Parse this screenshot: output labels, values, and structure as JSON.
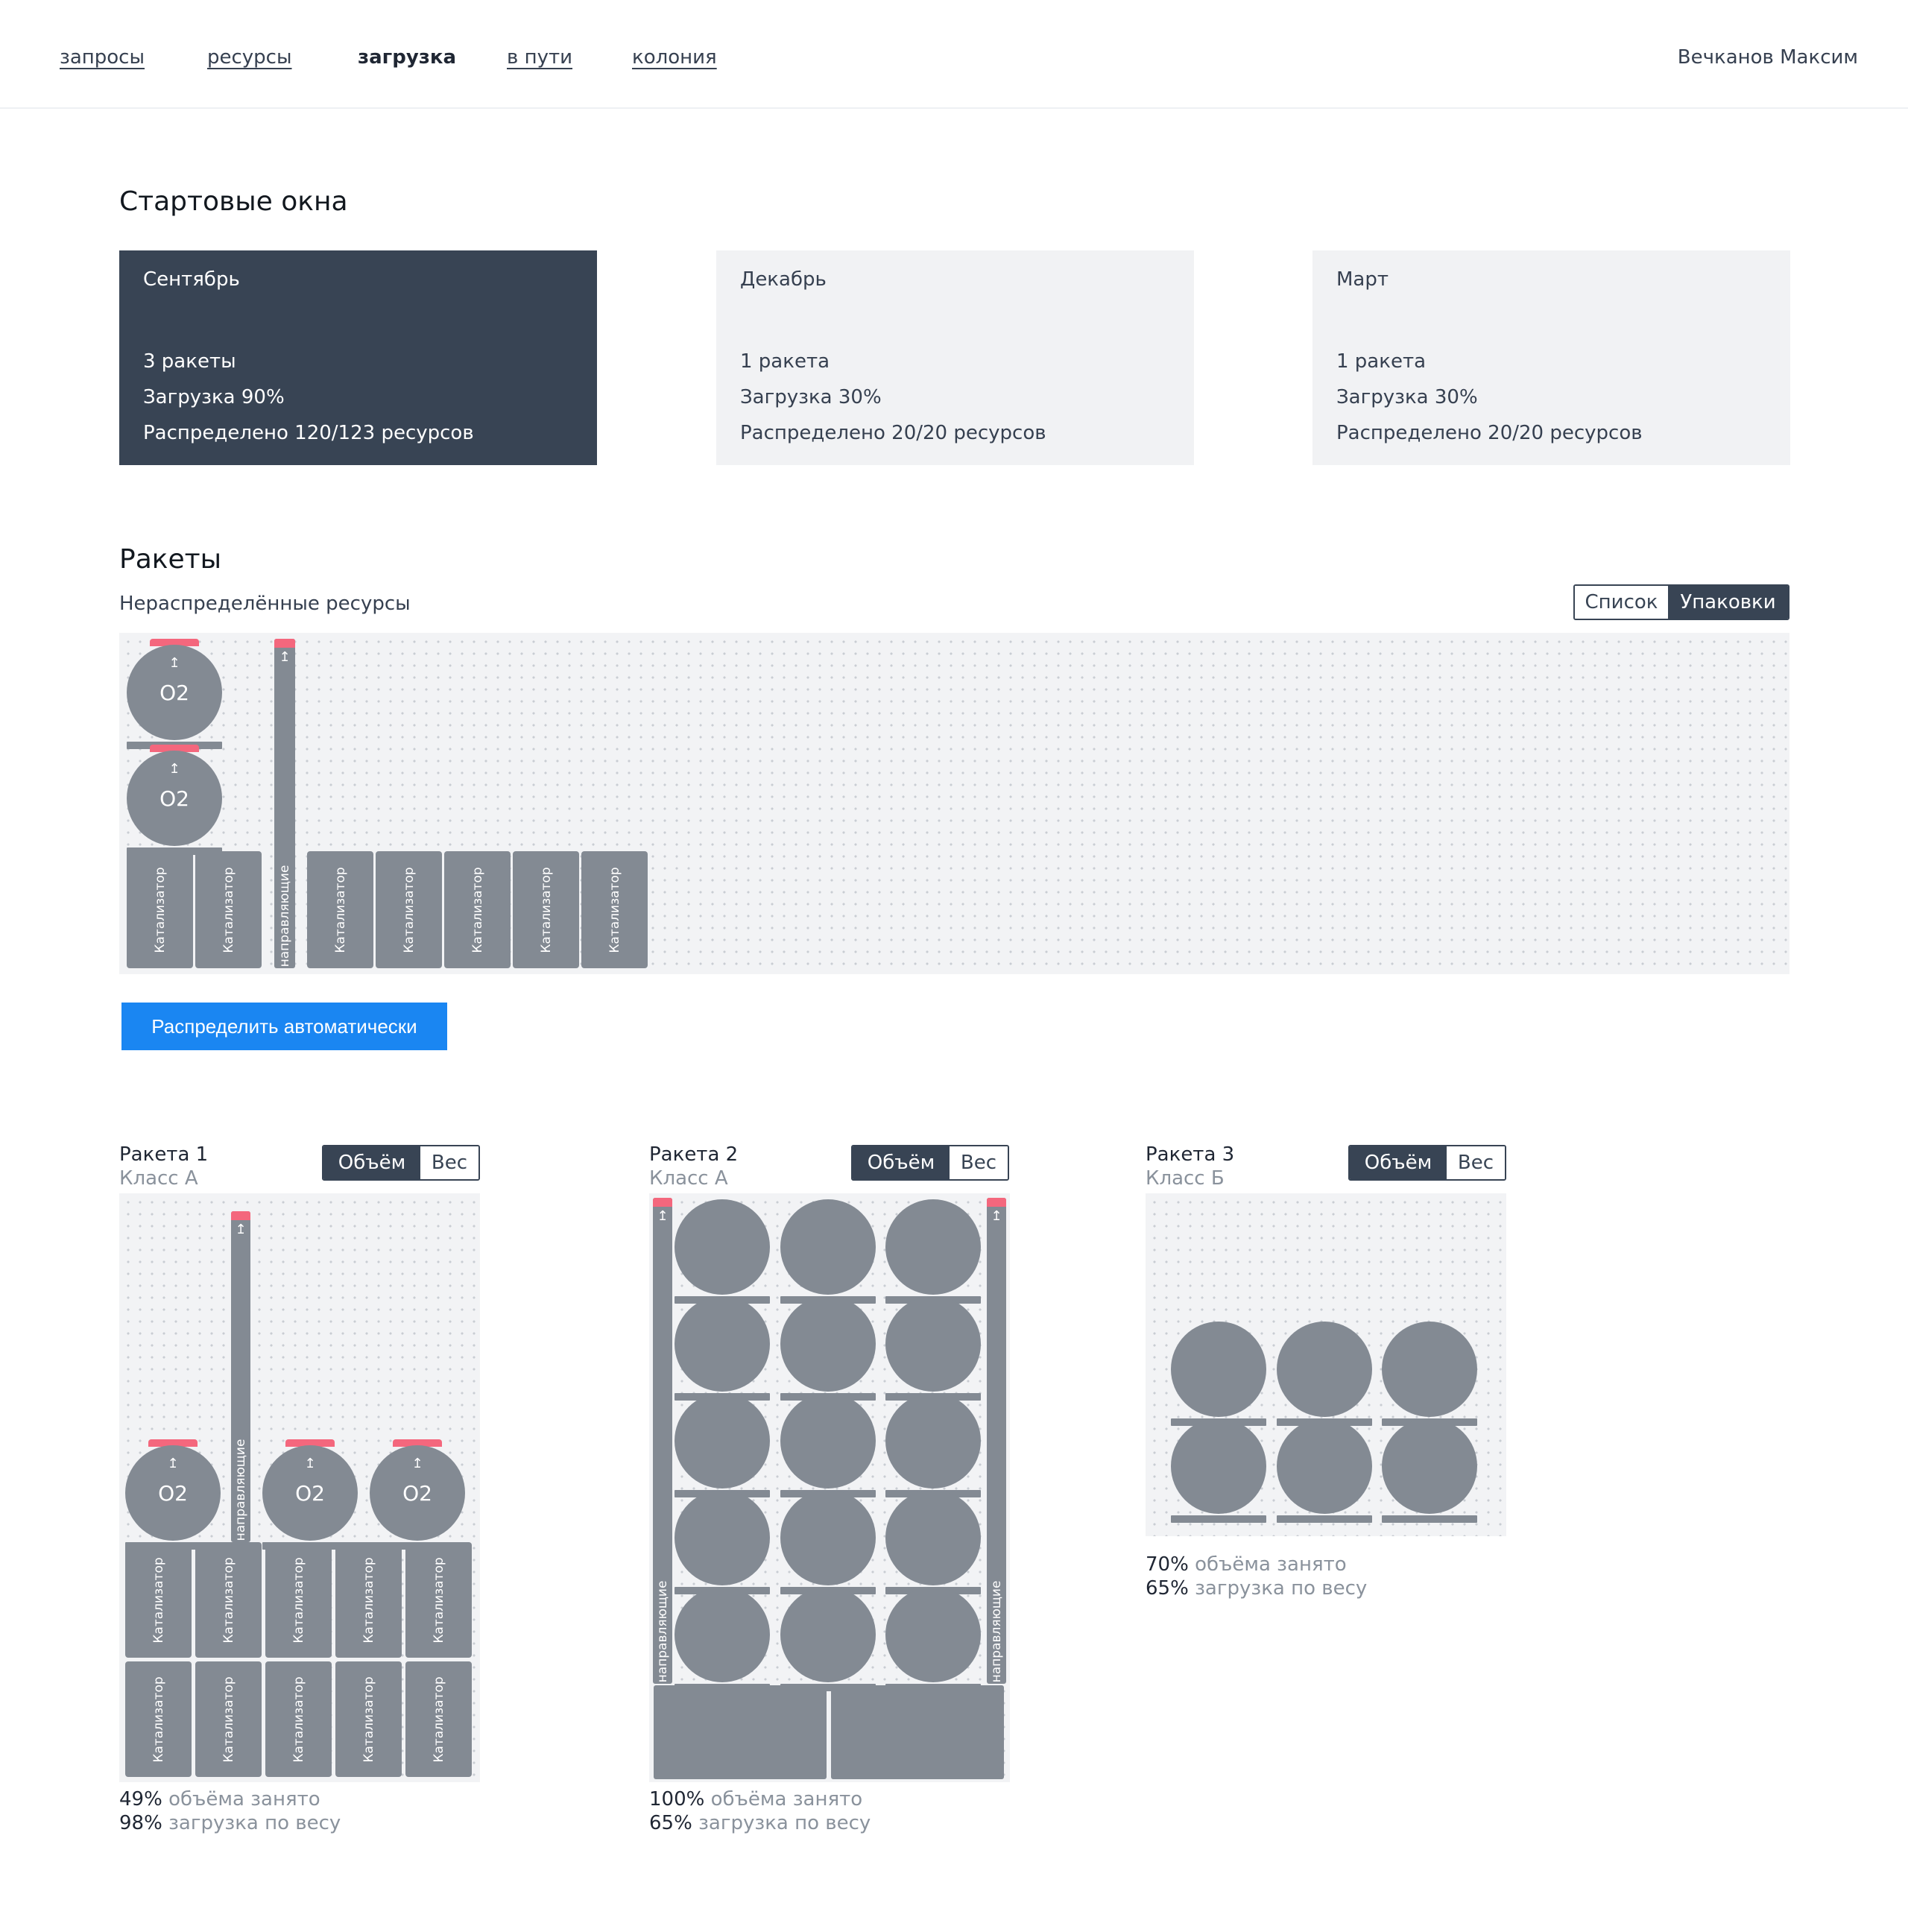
{
  "nav": {
    "items": [
      {
        "label": "запросы"
      },
      {
        "label": "ресурсы"
      },
      {
        "label": "загрузка"
      },
      {
        "label": "в пути"
      },
      {
        "label": "колония"
      }
    ],
    "user": "Вечканов Максим"
  },
  "launch_windows": {
    "title": "Стартовые окна",
    "cards": [
      {
        "name": "Сентябрь",
        "rockets": "3 ракеты",
        "load": "Загрузка 90%",
        "distributed": "Распределено 120/123 ресурсов",
        "selected": true
      },
      {
        "name": "Декабрь",
        "rockets": "1 ракета",
        "load": "Загрузка 30%",
        "distributed": "Распределено 20/20 ресурсов",
        "selected": false
      },
      {
        "name": "Март",
        "rockets": "1 ракета",
        "load": "Загрузка 30%",
        "distributed": "Распределено 20/20 ресурсов",
        "selected": false
      }
    ]
  },
  "rockets_section": {
    "title": "Ракеты",
    "unassigned_label": "Нераспределённые ресурсы",
    "view_toggle": {
      "list": "Список",
      "packages": "Упаковки",
      "selected": "packages"
    },
    "auto_button": "Распределить автоматически"
  },
  "labels": {
    "o2": "O2",
    "catalyst": "Катализатор",
    "guides": "направляющие",
    "arrow": "↥"
  },
  "rockets": [
    {
      "title": "Ракета 1",
      "class": "Класс А",
      "toggle": {
        "volume": "Объём",
        "weight": "Вес",
        "selected": "volume"
      },
      "volume_pct": "49%",
      "volume_text": "объёма занято",
      "weight_pct": "98%",
      "weight_text": "загрузка по весу"
    },
    {
      "title": "Ракета 2",
      "class": "Класс А",
      "toggle": {
        "volume": "Объём",
        "weight": "Вес",
        "selected": "volume"
      },
      "volume_pct": "100%",
      "volume_text": "объёма занято",
      "weight_pct": "65%",
      "weight_text": "загрузка по весу"
    },
    {
      "title": "Ракета 3",
      "class": "Класс Б",
      "toggle": {
        "volume": "Объём",
        "weight": "Вес",
        "selected": "volume"
      },
      "volume_pct": "70%",
      "volume_text": "объёма занято",
      "weight_pct": "65%",
      "weight_text": "загрузка по весу"
    }
  ],
  "colors": {
    "dark": "#384454",
    "resource": "#838a93",
    "cap": "#f4677d",
    "accent": "#1a86f2",
    "panel": "#f2f3f5"
  }
}
